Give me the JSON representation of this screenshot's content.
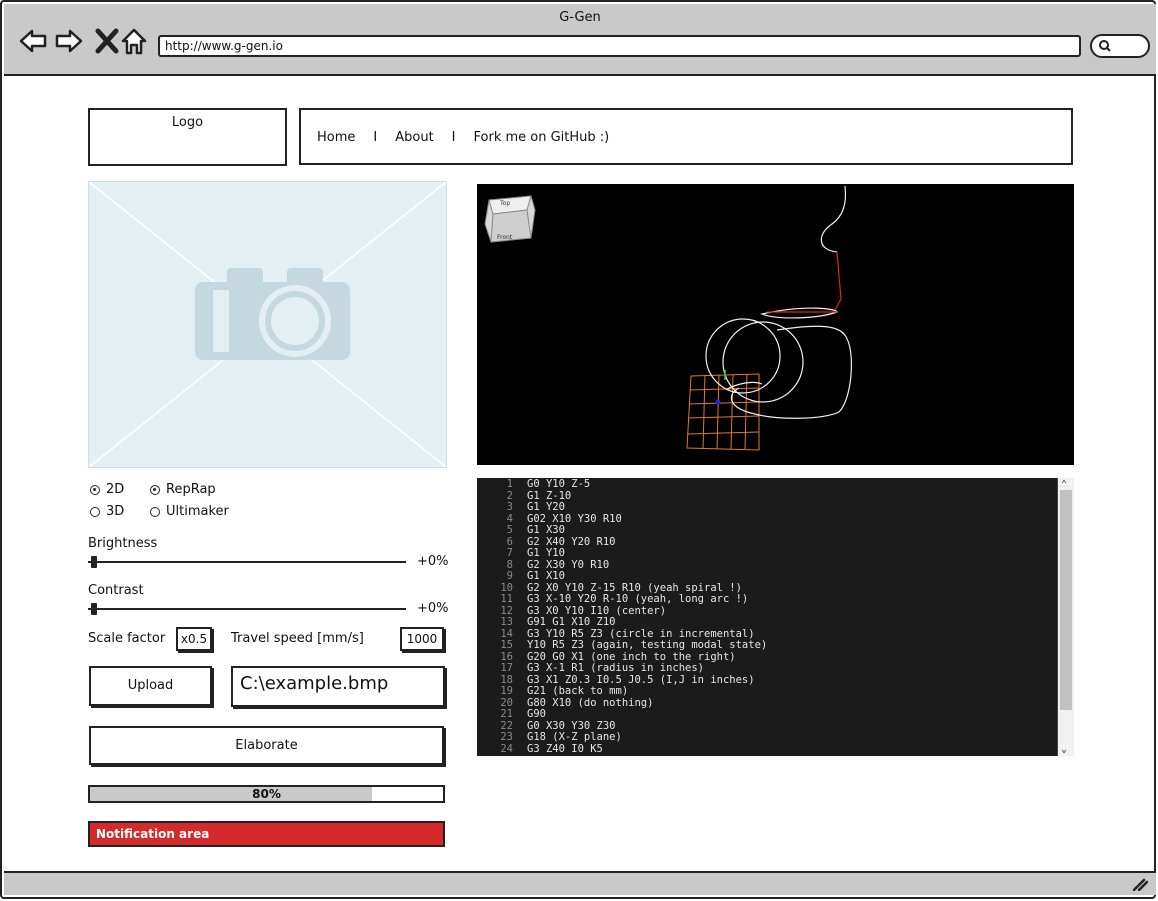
{
  "window": {
    "title": "G-Gen"
  },
  "browser": {
    "url": "http://www.g-gen.io"
  },
  "header": {
    "logo": "Logo",
    "nav": [
      "Home",
      "About",
      "Fork me on GitHub :)"
    ],
    "separator": "I"
  },
  "options": {
    "dim_2d": "2D",
    "dim_3d": "3D",
    "dim_selected": "2D",
    "firmware_reprap": "RepRap",
    "firmware_ultimaker": "Ultimaker",
    "firmware_selected": "RepRap"
  },
  "brightness": {
    "label": "Brightness",
    "value_text": "+0%",
    "value": 0
  },
  "contrast": {
    "label": "Contrast",
    "value_text": "+0%",
    "value": 0
  },
  "scale_factor": {
    "label": "Scale factor",
    "value": "x0.5"
  },
  "travel_speed": {
    "label": "Travel speed [mm/s]",
    "value": "1000"
  },
  "upload": {
    "label": "Upload"
  },
  "file": {
    "path": "C:\\example.bmp"
  },
  "elaborate": {
    "label": "Elaborate"
  },
  "progress": {
    "percent": 80,
    "text": "80%"
  },
  "notification": {
    "text": "Notification area",
    "color": "#d42a2a"
  },
  "viewer": {
    "cube_top": "Top",
    "cube_front": "Front"
  },
  "code_lines": [
    "G0 Y10 Z-5",
    "G1 Z-10",
    "G1 Y20",
    "G02 X10 Y30 R10",
    "G1 X30",
    "G2 X40 Y20 R10",
    "G1 Y10",
    "G2 X30 Y0 R10",
    "G1 X10",
    "G2 X0 Y10 Z-15 R10 (yeah spiral !)",
    "G3 X-10 Y20 R-10 (yeah, long arc !)",
    "G3 X0 Y10 I10 (center)",
    "G91 G1 X10 Z10",
    "G3 Y10 R5 Z3 (circle in incremental)",
    "Y10 R5 Z3 (again, testing modal state)",
    "G20 G0 X1 (one inch to the right)",
    "G3 X-1 R1 (radius in inches)",
    "G3 X1 Z0.3 I0.5 J0.5 (I,J in inches)",
    "G21 (back to mm)",
    "G80 X10 (do nothing)",
    "G90",
    "G0 X30 Y30 Z30",
    "G18 (X-Z plane)",
    "G3 Z40 I0 K5"
  ]
}
